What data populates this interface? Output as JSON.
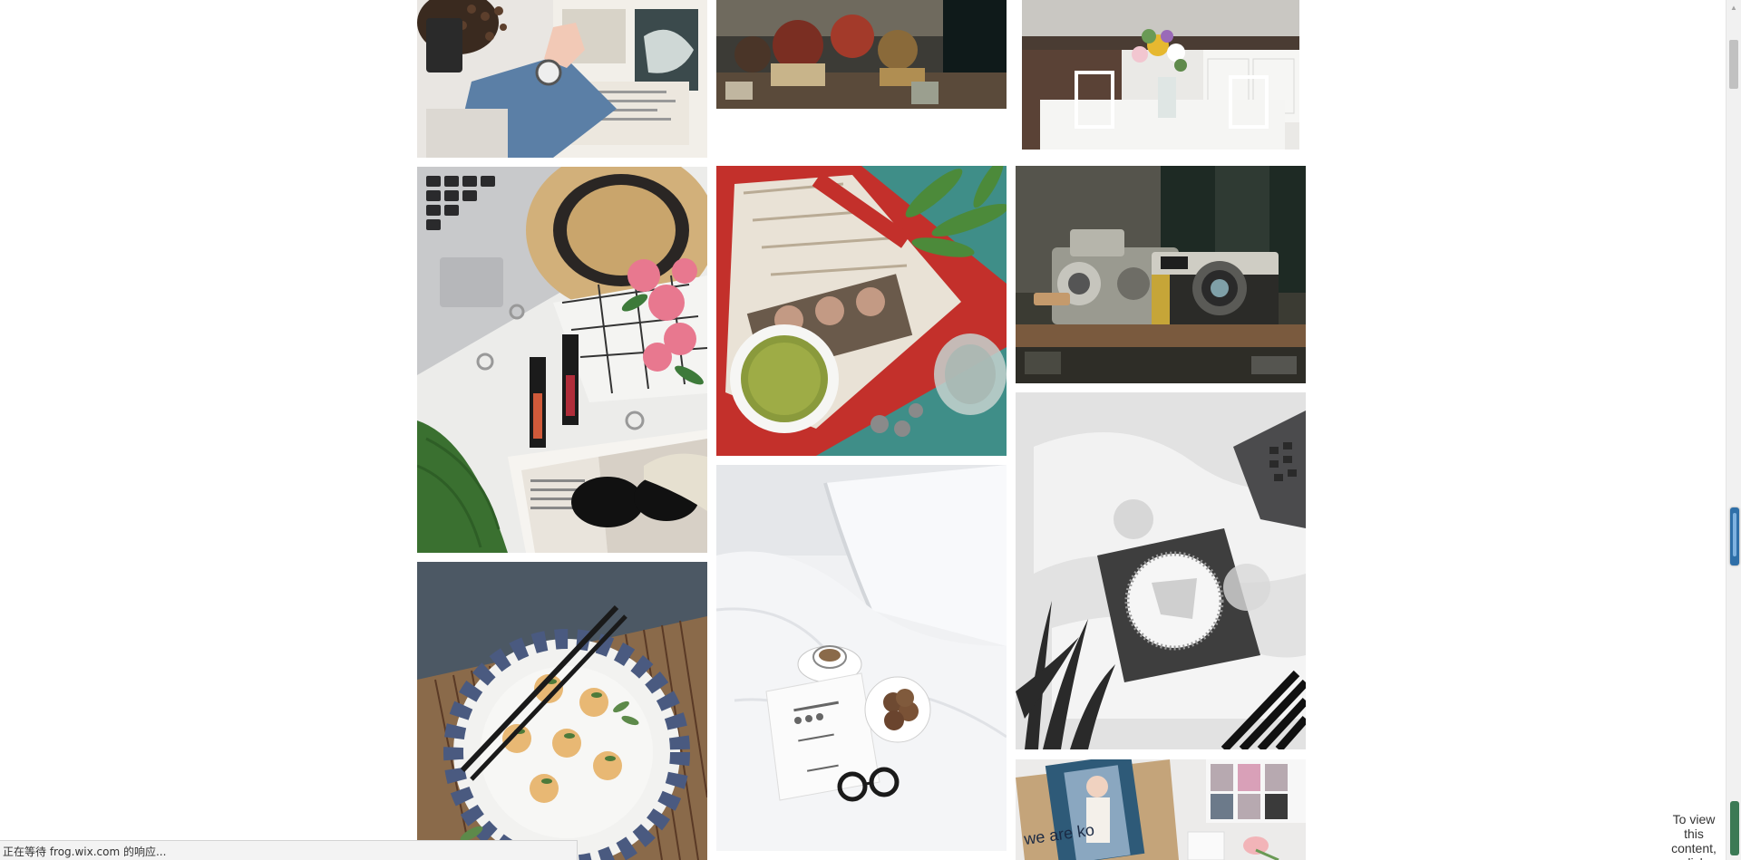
{
  "gallery": {
    "tiles": [
      {
        "name": "photo-magazine-coffee-watch",
        "description_icon": "image-icon"
      },
      {
        "name": "photo-market-stall",
        "description_icon": "image-icon"
      },
      {
        "name": "photo-kitchen-flowers",
        "description_icon": "image-icon"
      },
      {
        "name": "photo-hat-laptop-lipstick",
        "description_icon": "image-icon"
      },
      {
        "name": "photo-record-matcha",
        "description_icon": "image-icon"
      },
      {
        "name": "photo-vintage-cameras",
        "description_icon": "image-icon"
      },
      {
        "name": "photo-bed-breakfast-bw",
        "description_icon": "image-icon"
      },
      {
        "name": "photo-bed-coffee-cookies",
        "description_icon": "image-icon"
      },
      {
        "name": "photo-dumplings-plate",
        "description_icon": "image-icon"
      },
      {
        "name": "photo-magazine-flatlay",
        "description_icon": "image-icon"
      }
    ]
  },
  "embed_notice": {
    "line1": "To view",
    "line2": "this",
    "line3": "content,",
    "line4": "click"
  },
  "status_bar": {
    "text": "正在等待 frog.wix.com 的响应..."
  },
  "colors": {
    "background": "#ffffff",
    "status_bar_bg": "#f3f3f3",
    "scrollbar_thumb": "#c1c1c1"
  }
}
